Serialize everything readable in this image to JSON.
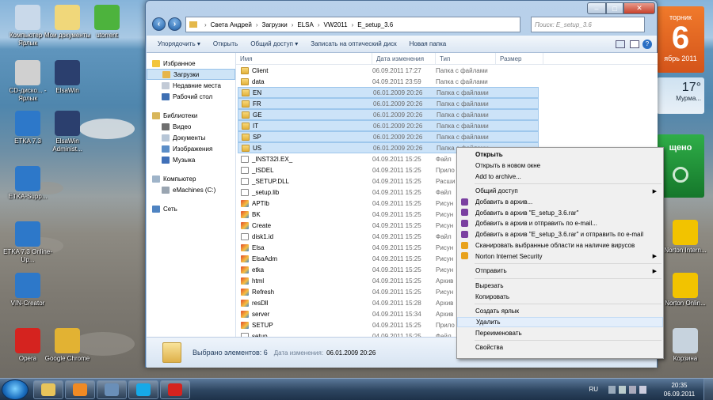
{
  "desktop": {
    "icons": [
      {
        "label": "Компьютер - Ярлык",
        "color": "#c9d9ea"
      },
      {
        "label": "Мои документы",
        "color": "#f0d77a"
      },
      {
        "label": "utorrent",
        "color": "#4db33d"
      },
      {
        "label": "CD-диско... - Ярлык",
        "color": "#d0d0d0"
      },
      {
        "label": "ElsaWin",
        "color": "#2b3f6e"
      },
      {
        "label": "ETKA 7.3",
        "color": "#2d78c9"
      },
      {
        "label": "ElsaWin Administ...",
        "color": "#2b3f6e"
      },
      {
        "label": "ETKA-Supp...",
        "color": "#2d78c9"
      },
      {
        "label": "ETKA 7.3 Online-Up...",
        "color": "#2d78c9"
      },
      {
        "label": "VIN-Creator",
        "color": "#2d78c9"
      },
      {
        "label": "Opera",
        "color": "#d5231f"
      },
      {
        "label": "Google Chrome",
        "color": "#e2b233"
      },
      {
        "label": "Norton Intern...",
        "color": "#f2c300"
      },
      {
        "label": "Norton Onlin...",
        "color": "#f2c300"
      },
      {
        "label": "Корзина",
        "color": "#c7d3de"
      }
    ],
    "gadgets": {
      "calendar_day": "торник",
      "calendar_date": "6",
      "calendar_month": "ябрь 2011",
      "weather_temp": "17°",
      "weather_city": "Мурма...",
      "security_status": "щено"
    }
  },
  "window": {
    "caption_buttons": [
      "–",
      "□",
      "✕"
    ],
    "address": [
      "Света Андрей",
      "Загрузки",
      "ELSA",
      "VW2011",
      "E_setup_3.6"
    ],
    "search_placeholder": "Поиск: E_setup_3.6",
    "toolbar": [
      "Упорядочить ▾",
      "Открыть",
      "Общий доступ ▾",
      "Записать на оптический диск",
      "Новая папка"
    ],
    "nav": [
      {
        "label": "Избранное",
        "sub": false,
        "sel": false,
        "color": "#f2c53d"
      },
      {
        "label": "Загрузки",
        "sub": true,
        "sel": true,
        "color": "#e6b54a"
      },
      {
        "label": "Недавние места",
        "sub": true,
        "sel": false,
        "color": "#c2cad6"
      },
      {
        "label": "Рабочий стол",
        "sub": true,
        "sel": false,
        "color": "#3e6fb3"
      },
      {
        "gap": true
      },
      {
        "label": "Библиотеки",
        "sub": false,
        "sel": false,
        "color": "#d8b65a"
      },
      {
        "label": "Видео",
        "sub": true,
        "sel": false,
        "color": "#6f6f6f"
      },
      {
        "label": "Документы",
        "sub": true,
        "sel": false,
        "color": "#b7c6d7"
      },
      {
        "label": "Изображения",
        "sub": true,
        "sel": false,
        "color": "#5b8dc7"
      },
      {
        "label": "Музыка",
        "sub": true,
        "sel": false,
        "color": "#4070b8"
      },
      {
        "gap": true
      },
      {
        "label": "Компьютер",
        "sub": false,
        "sel": false,
        "color": "#9fb4c9"
      },
      {
        "label": "eMachines (C:)",
        "sub": true,
        "sel": false,
        "color": "#9aa5b1"
      },
      {
        "gap": true
      },
      {
        "label": "Сеть",
        "sub": false,
        "sel": false,
        "color": "#4f84c2"
      }
    ],
    "columns": [
      "Имя",
      "Дата изменения",
      "Тип",
      "Размер"
    ],
    "rows": [
      {
        "name": "Client",
        "date": "06.09.2011 17:27",
        "type": "Папка с файлами",
        "icon": "folder",
        "sel": false
      },
      {
        "name": "data",
        "date": "04.09.2011 23:59",
        "type": "Папка с файлами",
        "icon": "folder",
        "sel": false
      },
      {
        "name": "EN",
        "date": "06.01.2009 20:26",
        "type": "Папка с файлами",
        "icon": "folder",
        "sel": true
      },
      {
        "name": "FR",
        "date": "06.01.2009 20:26",
        "type": "Папка с файлами",
        "icon": "folder",
        "sel": true
      },
      {
        "name": "GE",
        "date": "06.01.2009 20:26",
        "type": "Папка с файлами",
        "icon": "folder",
        "sel": true
      },
      {
        "name": "IT",
        "date": "06.01.2009 20:26",
        "type": "Папка с файлами",
        "icon": "folder",
        "sel": true
      },
      {
        "name": "SP",
        "date": "06.01.2009 20:26",
        "type": "Папка с файлами",
        "icon": "folder",
        "sel": true
      },
      {
        "name": "US",
        "date": "06.01.2009 20:26",
        "type": "Папка с файлами",
        "icon": "folder",
        "sel": true
      },
      {
        "name": "_INST32I.EX_",
        "date": "04.09.2011 15:25",
        "type": "Файл",
        "icon": "file",
        "sel": false
      },
      {
        "name": "_ISDEL",
        "date": "04.09.2011 15:25",
        "type": "Прило",
        "icon": "file",
        "sel": false
      },
      {
        "name": "_SETUP.DLL",
        "date": "04.09.2011 15:25",
        "type": "Расши",
        "icon": "file",
        "sel": false
      },
      {
        "name": "_setup.lib",
        "date": "04.09.2011 15:25",
        "type": "Файл",
        "icon": "file",
        "sel": false
      },
      {
        "name": "APTlb",
        "date": "04.09.2011 15:25",
        "type": "Рисун",
        "icon": "app",
        "sel": false
      },
      {
        "name": "BK",
        "date": "04.09.2011 15:25",
        "type": "Рисун",
        "icon": "app",
        "sel": false
      },
      {
        "name": "Create",
        "date": "04.09.2011 15:25",
        "type": "Рисун",
        "icon": "app",
        "sel": false
      },
      {
        "name": "disk1.id",
        "date": "04.09.2011 15:25",
        "type": "Файл",
        "icon": "file",
        "sel": false
      },
      {
        "name": "Elsa",
        "date": "04.09.2011 15:25",
        "type": "Рисун",
        "icon": "app",
        "sel": false
      },
      {
        "name": "ElsaAdm",
        "date": "04.09.2011 15:25",
        "type": "Рисун",
        "icon": "app",
        "sel": false
      },
      {
        "name": "etka",
        "date": "04.09.2011 15:25",
        "type": "Рисун",
        "icon": "app",
        "sel": false
      },
      {
        "name": "html",
        "date": "04.09.2011 15:25",
        "type": "Архив",
        "icon": "app",
        "sel": false
      },
      {
        "name": "Refresh",
        "date": "04.09.2011 15:25",
        "type": "Рисун",
        "icon": "app",
        "sel": false
      },
      {
        "name": "resDll",
        "date": "04.09.2011 15:28",
        "type": "Архив",
        "icon": "app",
        "sel": false
      },
      {
        "name": "server",
        "date": "04.09.2011 15:34",
        "type": "Архив",
        "icon": "app",
        "sel": false
      },
      {
        "name": "SETUP",
        "date": "04.09.2011 15:25",
        "type": "Прило",
        "icon": "app",
        "sel": false
      },
      {
        "name": "setup",
        "date": "04.09.2011 15:25",
        "type": "Файл",
        "icon": "file",
        "sel": false
      }
    ],
    "details": {
      "selected": "Выбрано элементов: 6",
      "date_label": "Дата изменения:",
      "date_value": "06.01.2009 20:26"
    }
  },
  "context_menu": [
    {
      "label": "Открыть",
      "bold": true
    },
    {
      "label": "Открыть в новом окне"
    },
    {
      "label": "Add to archive..."
    },
    {
      "sep": true
    },
    {
      "label": "Общий доступ",
      "arrow": true
    },
    {
      "label": "Добавить в архив...",
      "icon": "#7a3fa0"
    },
    {
      "label": "Добавить в архив \"E_setup_3.6.rar\"",
      "icon": "#7a3fa0"
    },
    {
      "label": "Добавить в архив и отправить по e-mail...",
      "icon": "#7a3fa0"
    },
    {
      "label": "Добавить в архив \"E_setup_3.6.rar\" и отправить по e-mail",
      "icon": "#7a3fa0"
    },
    {
      "label": "Сканировать выбранные области на наличие вирусов",
      "icon": "#e8a21c"
    },
    {
      "label": "Norton Internet Security",
      "icon": "#e8a21c",
      "arrow": true
    },
    {
      "sep": true
    },
    {
      "label": "Отправить",
      "arrow": true
    },
    {
      "sep": true
    },
    {
      "label": "Вырезать"
    },
    {
      "label": "Копировать"
    },
    {
      "sep": true
    },
    {
      "label": "Создать ярлык"
    },
    {
      "label": "Удалить",
      "hl": true
    },
    {
      "label": "Переименовать"
    },
    {
      "sep": true
    },
    {
      "label": "Свойства"
    }
  ],
  "taskbar": {
    "buttons": [
      {
        "name": "explorer",
        "color": "#e8c45a"
      },
      {
        "name": "media-player",
        "color": "#f08a24"
      },
      {
        "name": "tool",
        "color": "#6a8fb8"
      },
      {
        "name": "skype",
        "color": "#16a9e8"
      },
      {
        "name": "opera",
        "color": "#d5231f"
      }
    ],
    "lang": "RU",
    "time": "20:35",
    "date": "06.09.2011"
  }
}
